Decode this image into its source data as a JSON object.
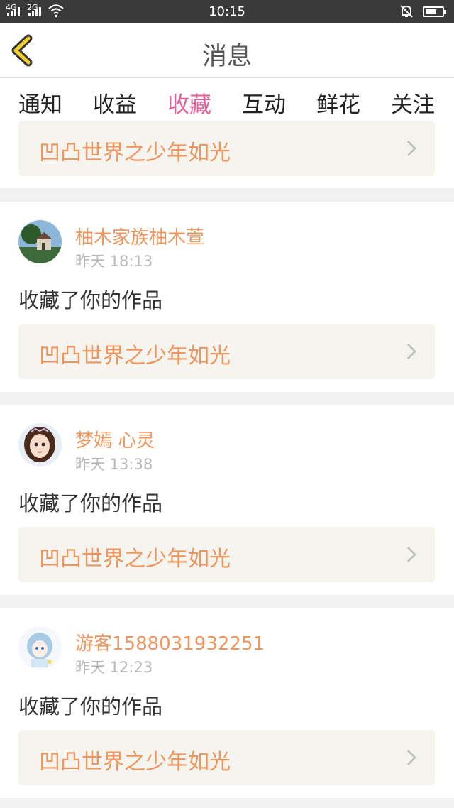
{
  "status_bar": {
    "time": "10:15",
    "sig1": "4G",
    "sig2": "2G",
    "battery_level": 0.7
  },
  "header": {
    "title": "消息"
  },
  "tabs": [
    {
      "label": "通知",
      "active": false
    },
    {
      "label": "收益",
      "active": false
    },
    {
      "label": "收藏",
      "active": true
    },
    {
      "label": "互动",
      "active": false
    },
    {
      "label": "鲜花",
      "active": false
    },
    {
      "label": "关注",
      "active": false
    }
  ],
  "accent_color": "#e4609a",
  "name_color": "#f0955d",
  "partial_item": {
    "work_title": "凹凸世界之少年如光"
  },
  "items": [
    {
      "user": "柚木家族柚木萱",
      "time": "昨天 18:13",
      "action": "收藏了你的作品",
      "work_title": "凹凸世界之少年如光",
      "avatar_icon": "landscape-avatar"
    },
    {
      "user": "梦嫣 心灵",
      "time": "昨天 13:38",
      "action": "收藏了你的作品",
      "work_title": "凹凸世界之少年如光",
      "avatar_icon": "girl-avatar"
    },
    {
      "user": "游客1588031932251",
      "time": "昨天 12:23",
      "action": "收藏了你的作品",
      "work_title": "凹凸世界之少年如光",
      "avatar_icon": "anime-avatar"
    }
  ]
}
